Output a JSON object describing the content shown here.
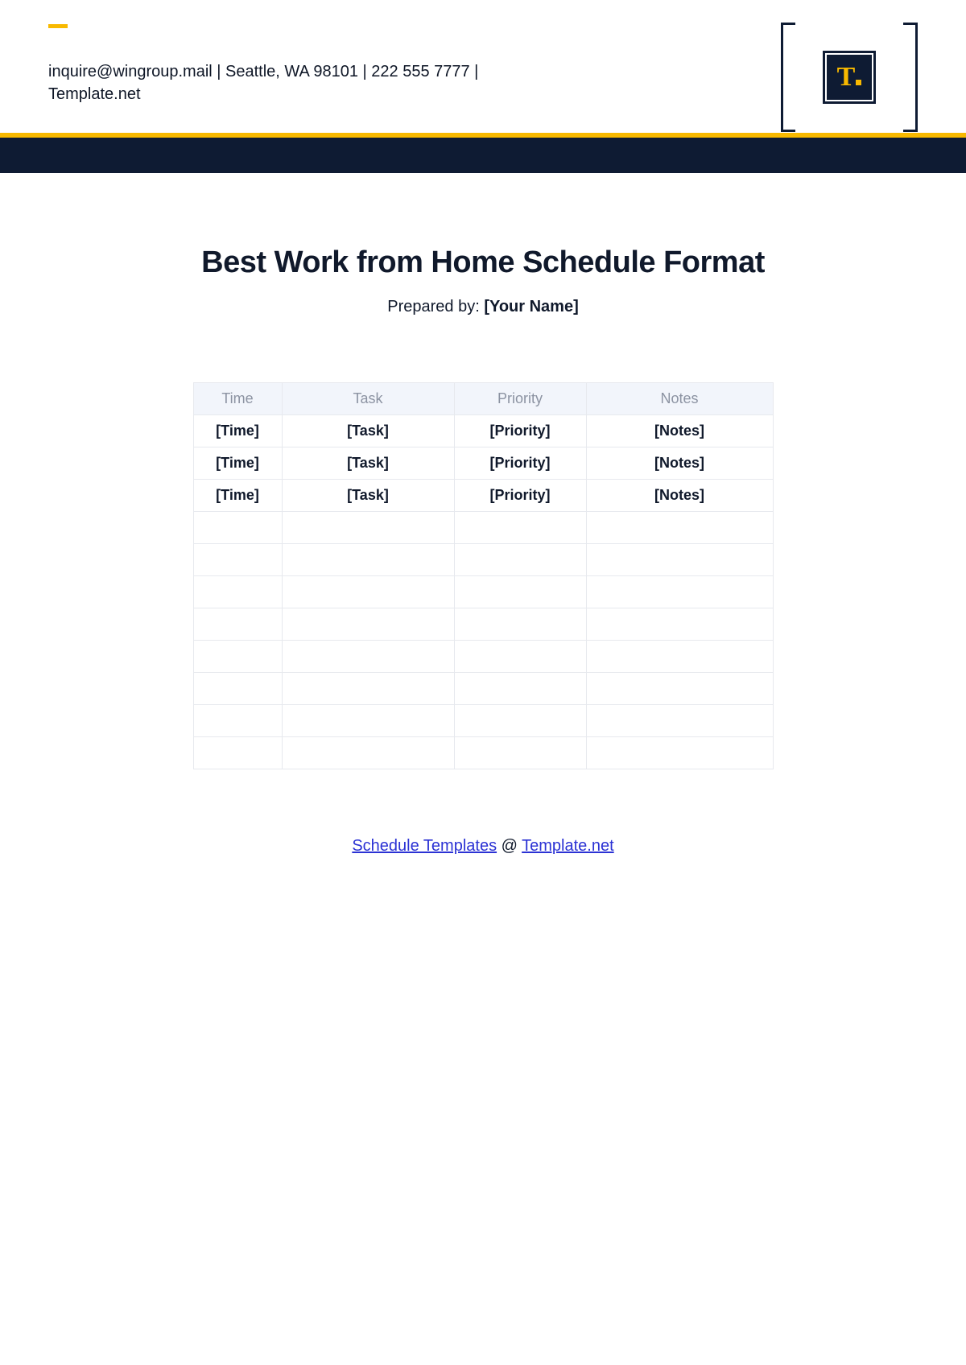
{
  "header": {
    "contact": "inquire@wingroup.mail | Seattle, WA 98101 | 222 555 7777 | Template.net",
    "logo_letter": "T"
  },
  "title": "Best Work from Home Schedule Format",
  "prepared_label": "Prepared by: ",
  "prepared_value": "[Your Name]",
  "table": {
    "headers": [
      "Time",
      "Task",
      "Priority",
      "Notes"
    ],
    "rows": [
      {
        "time": "[Time]",
        "task": "[Task]",
        "priority": "[Priority]",
        "notes": "[Notes]"
      },
      {
        "time": "[Time]",
        "task": "[Task]",
        "priority": "[Priority]",
        "notes": "[Notes]"
      },
      {
        "time": "[Time]",
        "task": "[Task]",
        "priority": "[Priority]",
        "notes": "[Notes]"
      },
      {
        "time": "",
        "task": "",
        "priority": "",
        "notes": ""
      },
      {
        "time": "",
        "task": "",
        "priority": "",
        "notes": ""
      },
      {
        "time": "",
        "task": "",
        "priority": "",
        "notes": ""
      },
      {
        "time": "",
        "task": "",
        "priority": "",
        "notes": ""
      },
      {
        "time": "",
        "task": "",
        "priority": "",
        "notes": ""
      },
      {
        "time": "",
        "task": "",
        "priority": "",
        "notes": ""
      },
      {
        "time": "",
        "task": "",
        "priority": "",
        "notes": ""
      },
      {
        "time": "",
        "task": "",
        "priority": "",
        "notes": ""
      }
    ]
  },
  "footer": {
    "link1": "Schedule Templates",
    "at": " @ ",
    "link2": "Template.net"
  }
}
